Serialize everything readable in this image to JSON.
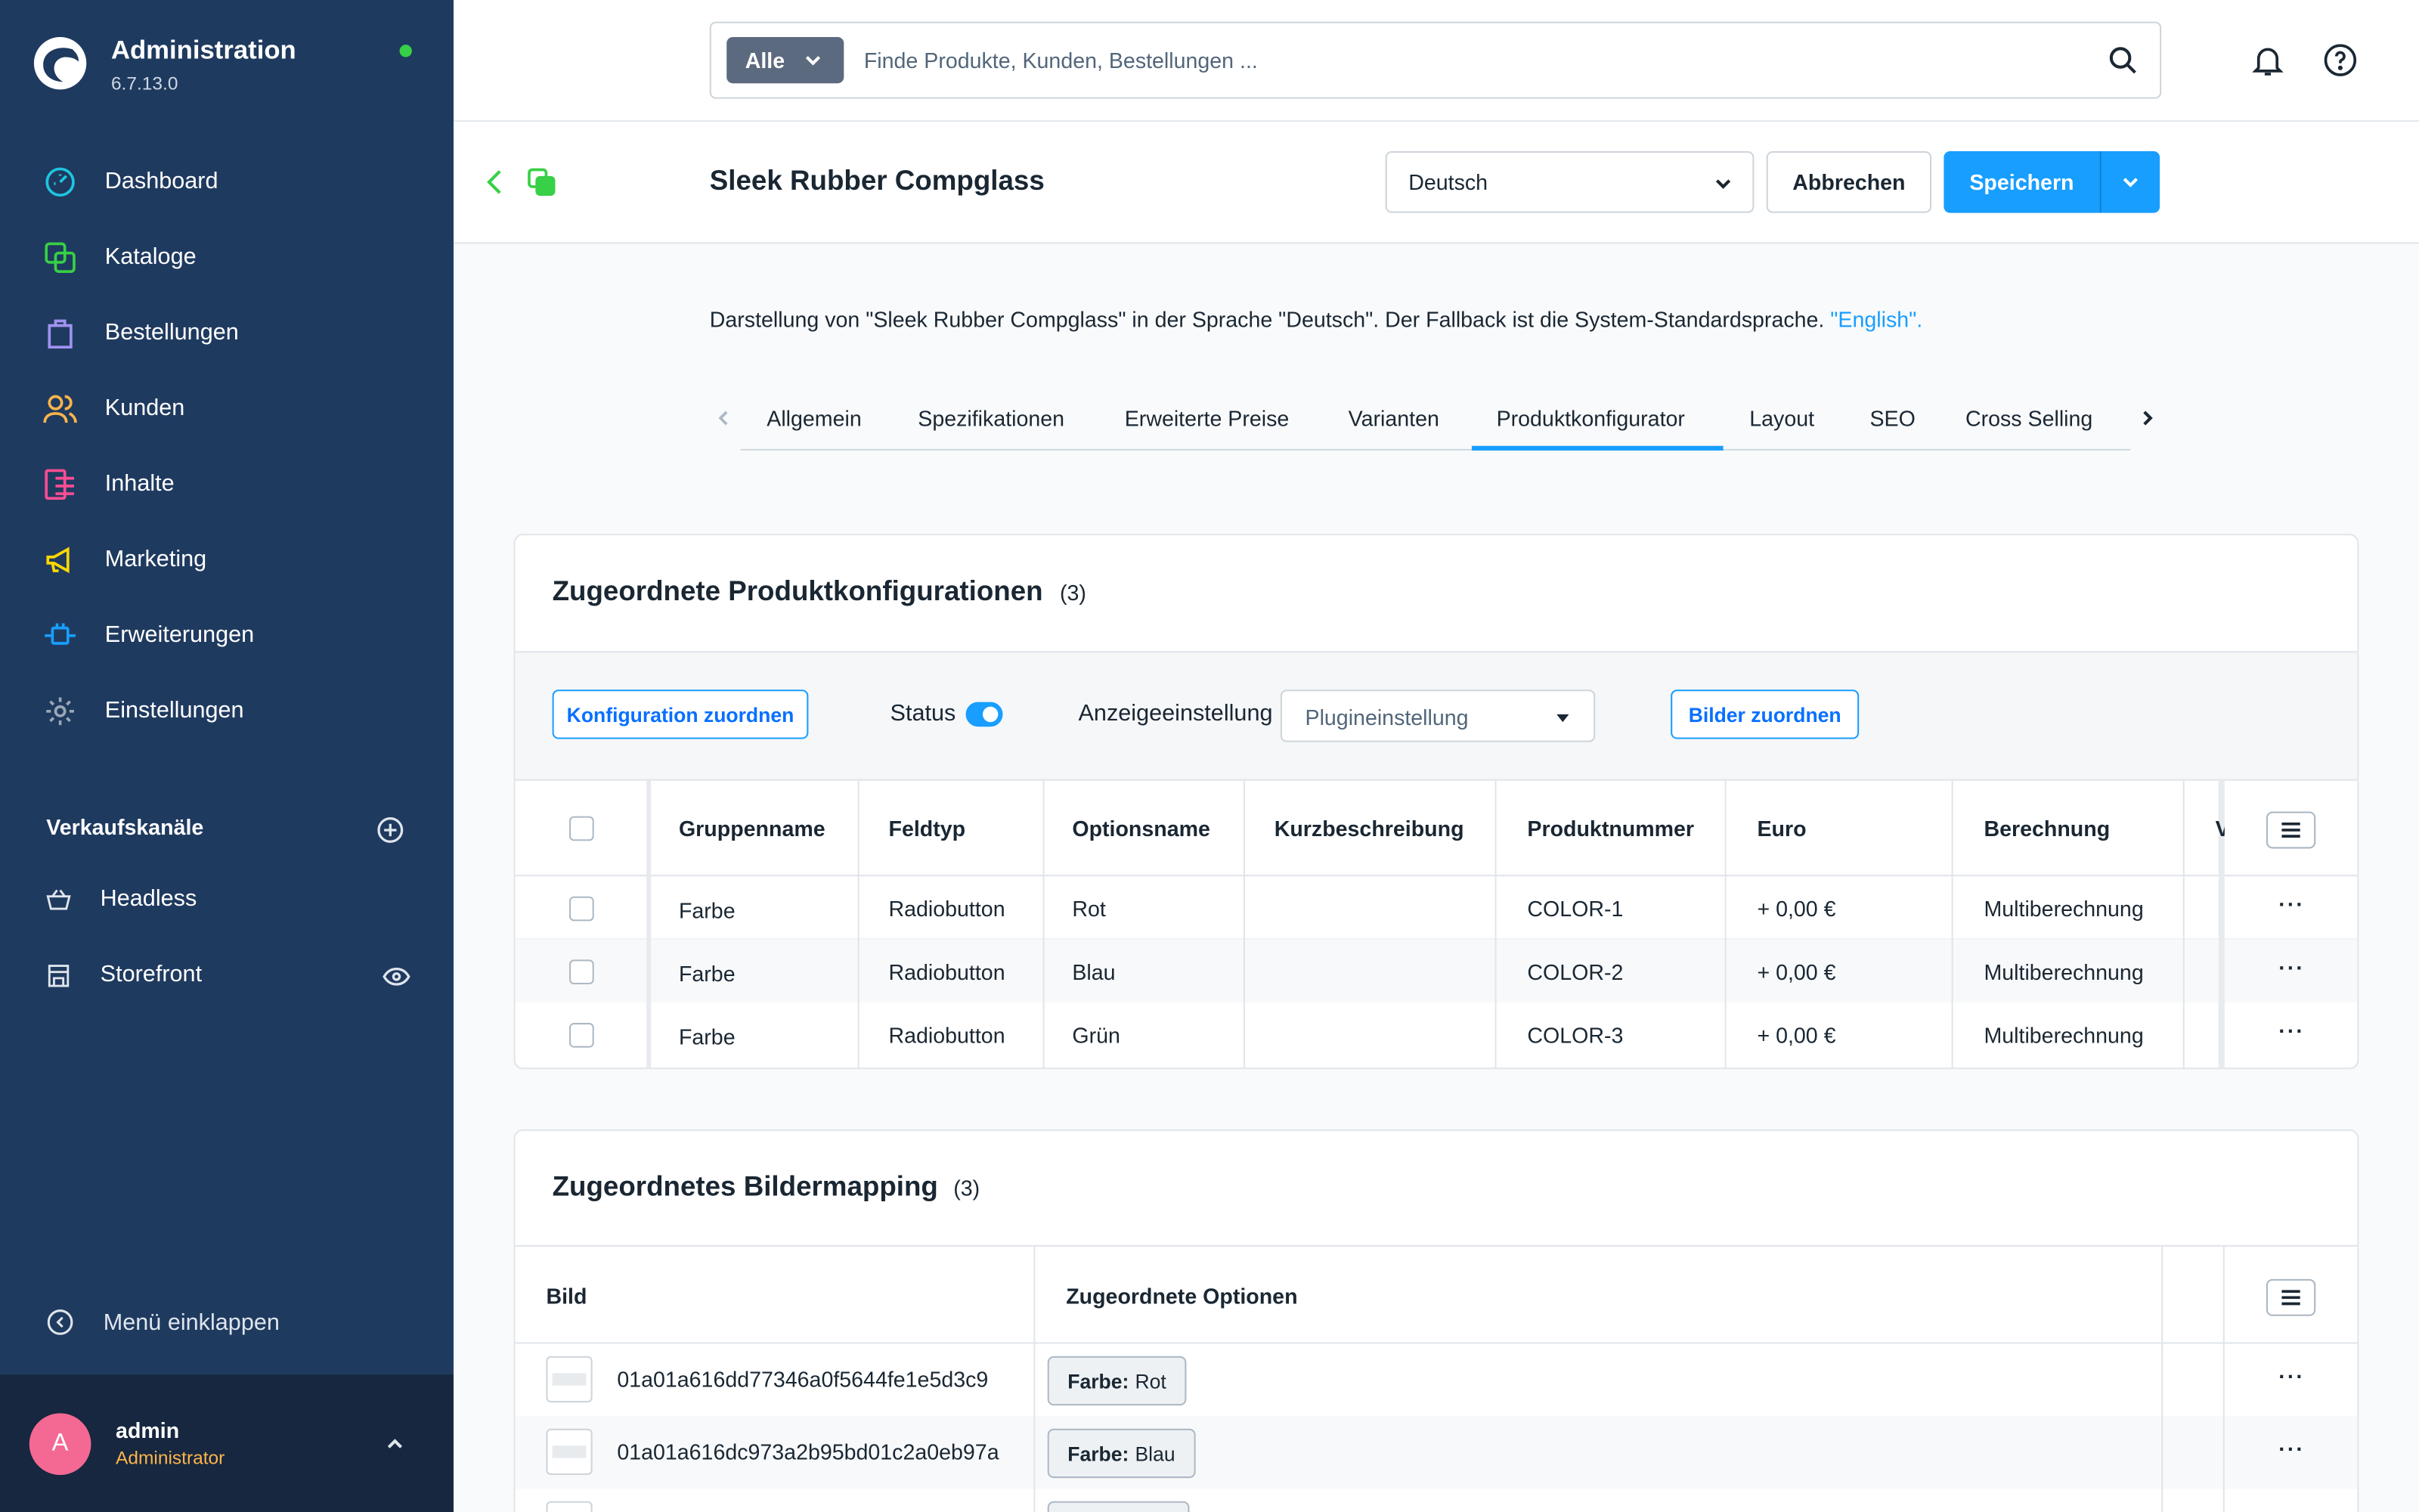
{
  "app": {
    "title": "Administration",
    "version": "6.7.13.0"
  },
  "sidebar": {
    "items": [
      {
        "label": "Dashboard",
        "icon": "dashboard-icon",
        "color": "#1ec5e0"
      },
      {
        "label": "Kataloge",
        "icon": "catalog-icon",
        "color": "#37d046"
      },
      {
        "label": "Bestellungen",
        "icon": "orders-icon",
        "color": "#a092f0"
      },
      {
        "label": "Kunden",
        "icon": "customers-icon",
        "color": "#ffb44a"
      },
      {
        "label": "Inhalte",
        "icon": "content-icon",
        "color": "#ff4d94"
      },
      {
        "label": "Marketing",
        "icon": "marketing-icon",
        "color": "#ffd700"
      },
      {
        "label": "Erweiterungen",
        "icon": "extensions-icon",
        "color": "#189eff"
      },
      {
        "label": "Einstellungen",
        "icon": "settings-icon",
        "color": "#9aa8b5"
      }
    ],
    "channels_title": "Verkaufskanäle",
    "channels": [
      {
        "label": "Headless",
        "icon": "basket-icon"
      },
      {
        "label": "Storefront",
        "icon": "store-icon"
      }
    ],
    "collapse_label": "Menü einklappen",
    "user": {
      "initial": "A",
      "name": "admin",
      "role": "Administrator"
    }
  },
  "search": {
    "type_label": "Alle",
    "placeholder": "Finde Produkte, Kunden, Bestellungen ..."
  },
  "header": {
    "title": "Sleek Rubber Compglass",
    "language": "Deutsch",
    "cancel_label": "Abbrechen",
    "save_label": "Speichern"
  },
  "info": {
    "text": "Darstellung von \"Sleek Rubber Compglass\" in der Sprache \"Deutsch\". Der Fallback ist die System-Standardsprache. ",
    "link": "\"English\"."
  },
  "tabs": [
    "Allgemein",
    "Spezifikationen",
    "Erweiterte Preise",
    "Varianten",
    "Produktkonfigurator",
    "Layout",
    "SEO",
    "Cross Selling"
  ],
  "active_tab": "Produktkonfigurator",
  "config_card": {
    "title": "Zugeordnete Produktkonfigurationen",
    "count": "(3)",
    "assign_button": "Konfiguration zuordnen",
    "status_label": "Status",
    "status_on": true,
    "display_label": "Anzeigeeinstellung",
    "display_value": "Plugineinstellung",
    "images_button": "Bilder zuordnen",
    "columns": [
      "Gruppenname",
      "Feldtyp",
      "Optionsname",
      "Kurzbeschreibung",
      "Produktnummer",
      "Euro",
      "Berechnung",
      "V"
    ],
    "rows": [
      [
        "Farbe",
        "Radiobutton",
        "Rot",
        "",
        "COLOR-1",
        "+ 0,00 €",
        "Multiberechnung"
      ],
      [
        "Farbe",
        "Radiobutton",
        "Blau",
        "",
        "COLOR-2",
        "+ 0,00 €",
        "Multiberechnung"
      ],
      [
        "Farbe",
        "Radiobutton",
        "Grün",
        "",
        "COLOR-3",
        "+ 0,00 €",
        "Multiberechnung"
      ]
    ],
    "row_action": "···"
  },
  "image_card": {
    "title": "Zugeordnetes Bildermapping",
    "count": "(3)",
    "columns": [
      "Bild",
      "Zugeordnete Optionen"
    ],
    "rows": [
      {
        "id": "01a01a616dd77346a0f5644fe1e5d3c9",
        "group": "Farbe:",
        "option": "Rot"
      },
      {
        "id": "01a01a616dc973a2b95bd01c2a0eb97a",
        "group": "Farbe:",
        "option": "Blau"
      }
    ],
    "row_action": "···"
  }
}
